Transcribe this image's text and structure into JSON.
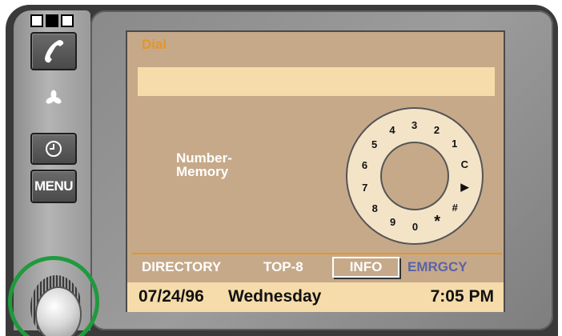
{
  "screen": {
    "title": "Dial",
    "number_field_value": "",
    "memory_label_line1": "Number-",
    "memory_label_line2": "Memory"
  },
  "dial_keys": [
    {
      "label": "4",
      "name": "dial-key-4"
    },
    {
      "label": "3",
      "name": "dial-key-3"
    },
    {
      "label": "2",
      "name": "dial-key-2"
    },
    {
      "label": "1",
      "name": "dial-key-1"
    },
    {
      "label": "C",
      "name": "dial-key-clear"
    },
    {
      "label": "▶",
      "name": "dial-key-call"
    },
    {
      "label": "#",
      "name": "dial-key-hash"
    },
    {
      "label": "*",
      "name": "dial-key-star"
    },
    {
      "label": "0",
      "name": "dial-key-0"
    },
    {
      "label": "9",
      "name": "dial-key-9"
    },
    {
      "label": "8",
      "name": "dial-key-8"
    },
    {
      "label": "7",
      "name": "dial-key-7"
    },
    {
      "label": "6",
      "name": "dial-key-6"
    },
    {
      "label": "5",
      "name": "dial-key-5"
    }
  ],
  "softkeys": {
    "directory": "DIRECTORY",
    "top8": "TOP-8",
    "info": "INFO",
    "emrgcy": "EMRGCY"
  },
  "statusbar": {
    "date": "07/24/96",
    "day": "Wednesday",
    "time": "7:05 PM"
  },
  "hardware_buttons": {
    "menu": "MENU",
    "phone_icon": "phone-handset-icon",
    "clock_icon": "clock-icon",
    "fan_icon": "fan-icon"
  },
  "colors": {
    "lcd_background": "#c6a989",
    "highlight_bar": "#f5dcaa",
    "title_orange": "#e3962a",
    "emergency_blue": "#5a63a6",
    "knob_ring_green": "#1f9a3d"
  }
}
